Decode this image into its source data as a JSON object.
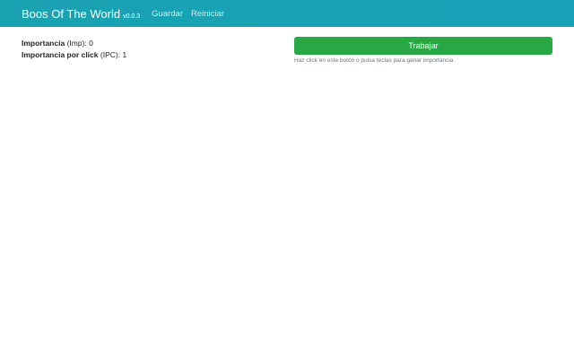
{
  "navbar": {
    "brand_title": "Boos Of The World",
    "brand_version": "v0.0.3",
    "links": [
      {
        "label": "Guardar"
      },
      {
        "label": "Reiniciar"
      }
    ],
    "colors": {
      "background": "#17a2b8",
      "link": "#cde9ee"
    }
  },
  "stats": {
    "importance": {
      "label": "Importancia",
      "abbr": "(Imp):",
      "value": "0"
    },
    "importance_per_click": {
      "label": "Importancia por click",
      "abbr": "(IPC):",
      "value": "1"
    }
  },
  "work": {
    "button_label": "Trabajar",
    "hint": "Haz click en este botón o pulsa teclas para ganar importancia",
    "button_color": "#28a745"
  }
}
